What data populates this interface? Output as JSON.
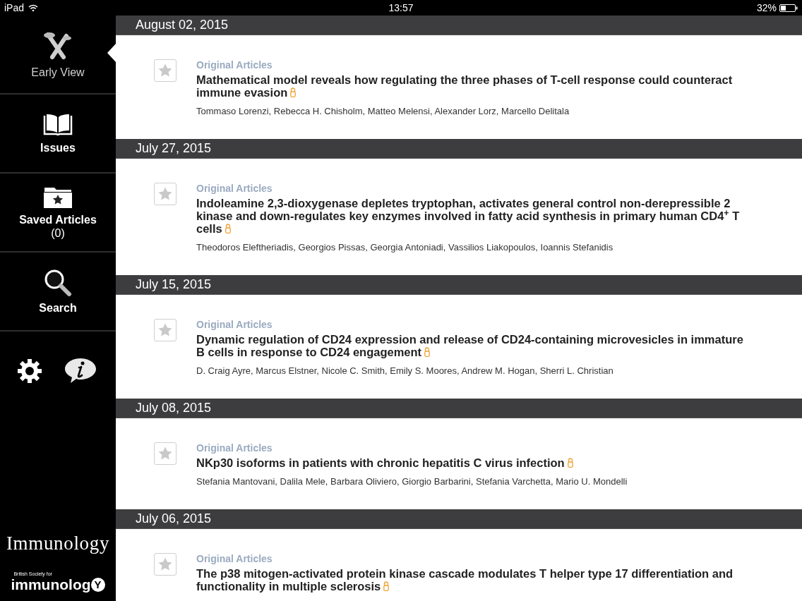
{
  "status_bar": {
    "device": "iPad",
    "time": "13:57",
    "battery": "32%"
  },
  "sidebar": {
    "items": [
      {
        "kind": "early-view",
        "label": "Early View",
        "selected": true
      },
      {
        "kind": "issues",
        "label": "Issues",
        "selected": false
      },
      {
        "kind": "saved",
        "label": "Saved Articles",
        "count": "(0)",
        "selected": false
      },
      {
        "kind": "search",
        "label": "Search",
        "selected": false
      }
    ],
    "journal_title": "Immunology",
    "society_caption": "British Society for",
    "society_name": "immunolog",
    "society_mark": "Y"
  },
  "feed": [
    {
      "date": "August 02, 2015",
      "articles": [
        {
          "category": "Original Articles",
          "title": "Mathematical model reveals how regulating the three phases of T-cell response could counteract immune evasion",
          "open_access": true,
          "saved": false,
          "authors": "Tommaso Lorenzi, Rebecca H. Chisholm, Matteo Melensi, Alexander Lorz, Marcello Delitala"
        }
      ]
    },
    {
      "date": "July 27, 2015",
      "articles": [
        {
          "category": "Original Articles",
          "title": "Indoleamine 2,3-dioxygenase depletes tryptophan, activates general control non-derepressible 2 kinase and down-regulates key enzymes involved in fatty acid synthesis in primary human CD4$^{+}$ T cells",
          "open_access": true,
          "saved": false,
          "authors": "Theodoros Eleftheriadis, Georgios Pissas, Georgia Antoniadi, Vassilios Liakopoulos, Ioannis Stefanidis"
        }
      ]
    },
    {
      "date": "July 15, 2015",
      "articles": [
        {
          "category": "Original Articles",
          "title": "Dynamic regulation of CD24 expression and release of CD24-containing microvesicles in immature B cells in response to CD24 engagement",
          "open_access": true,
          "saved": false,
          "authors": "D. Craig Ayre, Marcus Elstner, Nicole C. Smith, Emily S. Moores, Andrew M. Hogan, Sherri L. Christian"
        }
      ]
    },
    {
      "date": "July 08, 2015",
      "articles": [
        {
          "category": "Original Articles",
          "title": "NKp30 isoforms in patients with chronic hepatitis C virus infection",
          "open_access": true,
          "saved": false,
          "authors": "Stefania Mantovani, Dalila Mele, Barbara Oliviero, Giorgio Barbarini, Stefania Varchetta, Mario U. Mondelli"
        }
      ]
    },
    {
      "date": "July 06, 2015",
      "articles": [
        {
          "category": "Original Articles",
          "title": "The p38 mitogen-activated protein kinase cascade modulates T helper type 17 differentiation and functionality in multiple sclerosis",
          "open_access": true,
          "saved": false
        }
      ]
    }
  ]
}
